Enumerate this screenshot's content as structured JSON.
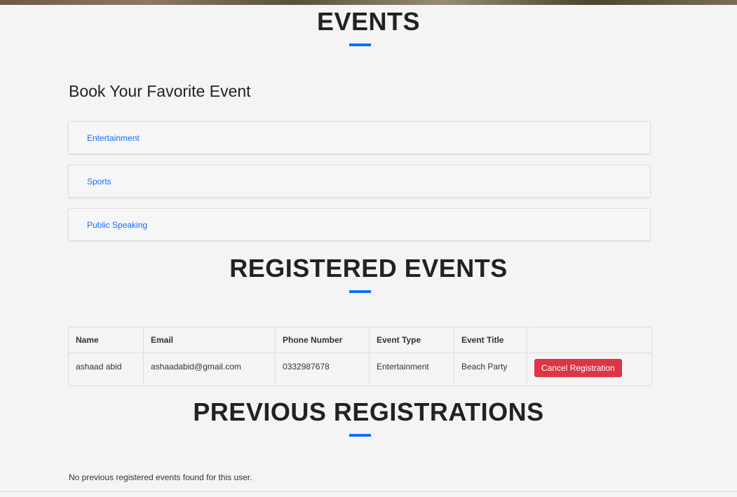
{
  "events_section": {
    "title": "EVENTS",
    "subtitle": "Book Your Favorite Event",
    "categories": [
      "Entertainment",
      "Sports",
      "Public Speaking"
    ]
  },
  "registered_section": {
    "title": "REGISTERED EVENTS",
    "columns": [
      "Name",
      "Email",
      "Phone Number",
      "Event Type",
      "Event Title",
      ""
    ],
    "rows": [
      {
        "name": "ashaad abid",
        "email": "ashaadabid@gmail.com",
        "phone": "0332987678",
        "event_type": "Entertainment",
        "event_title": "Beach Party",
        "action_label": "Cancel Registration"
      }
    ]
  },
  "previous_section": {
    "title": "PREVIOUS REGISTRATIONS",
    "empty_message": "No previous registered events found for this user."
  },
  "colors": {
    "accent": "#0d6efd",
    "danger": "#dc3545",
    "background": "#f4f4f4"
  }
}
